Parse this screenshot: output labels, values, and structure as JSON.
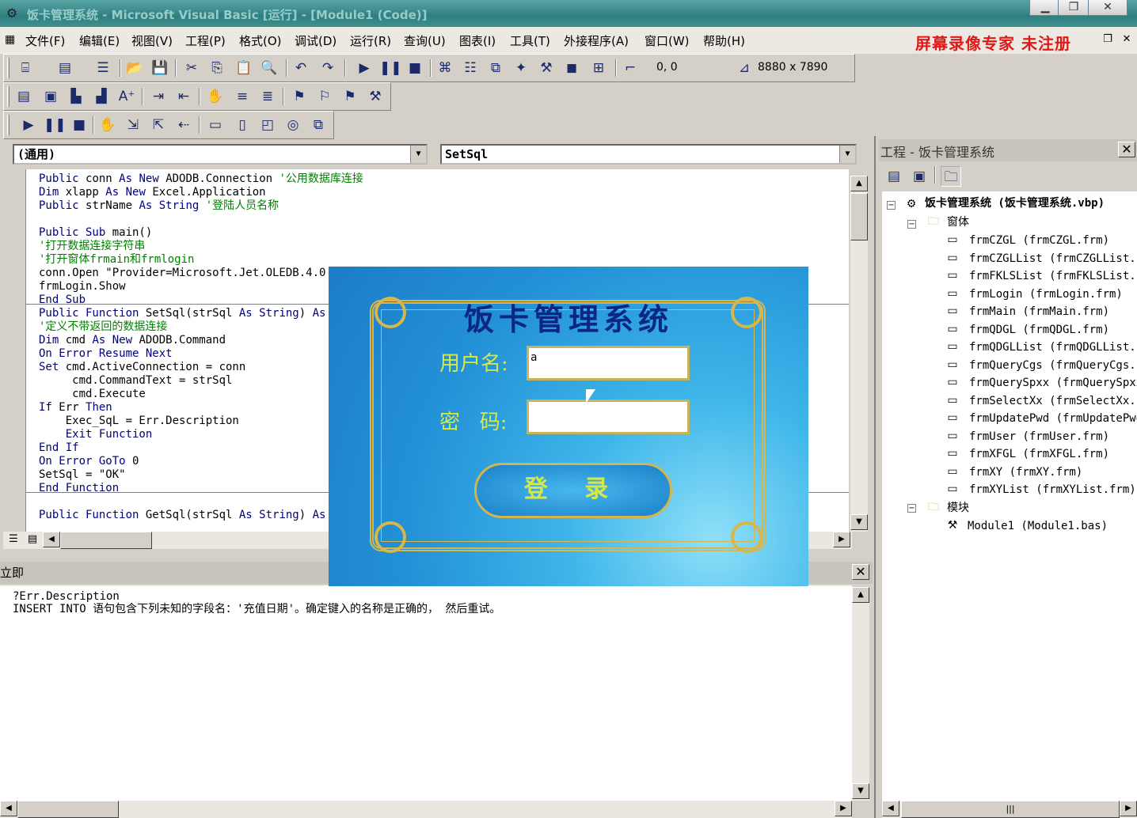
{
  "title_bar": {
    "title": "饭卡管理系统 - Microsoft Visual Basic [运行] - [Module1 (Code)]"
  },
  "menu": {
    "items": [
      "文件(F)",
      "编辑(E)",
      "视图(V)",
      "工程(P)",
      "格式(O)",
      "调试(D)",
      "运行(R)",
      "查询(U)",
      "图表(I)",
      "工具(T)",
      "外接程序(A)",
      "窗口(W)",
      "帮助(H)"
    ],
    "recorder_label": "屏幕录像专家  未注册"
  },
  "toolbar": {
    "position": "0, 0",
    "size": "8880 x 7890"
  },
  "code_window": {
    "object_combo": "(通用)",
    "procedure_combo": "SetSql",
    "lines": [
      [
        {
          "t": "Public ",
          "c": "kw"
        },
        {
          "t": "conn ",
          "c": ""
        },
        {
          "t": "As New ",
          "c": "kw"
        },
        {
          "t": "ADODB.Connection ",
          "c": ""
        },
        {
          "t": "'公用数据库连接",
          "c": "cm"
        }
      ],
      [
        {
          "t": "Dim ",
          "c": "kw"
        },
        {
          "t": "xlapp ",
          "c": ""
        },
        {
          "t": "As New ",
          "c": "kw"
        },
        {
          "t": "Excel.Application",
          "c": ""
        }
      ],
      [
        {
          "t": "Public ",
          "c": "kw"
        },
        {
          "t": "strName ",
          "c": ""
        },
        {
          "t": "As String ",
          "c": "kw"
        },
        {
          "t": "'登陆人员名称",
          "c": "cm"
        }
      ],
      [],
      [
        {
          "t": "Public Sub ",
          "c": "kw"
        },
        {
          "t": "main()",
          "c": ""
        }
      ],
      [
        {
          "t": "'打开数据连接字符串",
          "c": "cm"
        }
      ],
      [
        {
          "t": "'打开窗体frmain和frmlogin",
          "c": "cm"
        }
      ],
      [
        {
          "t": "conn.Open \"Provider=Microsoft.Jet.OLEDB.4.0",
          "c": ""
        }
      ],
      [
        {
          "t": "frmLogin.Show",
          "c": ""
        }
      ],
      [
        {
          "t": "End Sub",
          "c": "kw"
        }
      ],
      [
        {
          "t": "Public Function ",
          "c": "kw"
        },
        {
          "t": "SetSql(strSql ",
          "c": ""
        },
        {
          "t": "As String",
          "c": "kw"
        },
        {
          "t": ") ",
          "c": ""
        },
        {
          "t": "As",
          "c": "kw"
        }
      ],
      [
        {
          "t": "'定义不带返回的数据连接",
          "c": "cm"
        }
      ],
      [
        {
          "t": "Dim ",
          "c": "kw"
        },
        {
          "t": "cmd ",
          "c": ""
        },
        {
          "t": "As New ",
          "c": "kw"
        },
        {
          "t": "ADODB.Command",
          "c": ""
        }
      ],
      [
        {
          "t": "On Error Resume Next",
          "c": "kw"
        }
      ],
      [
        {
          "t": "Set ",
          "c": "kw"
        },
        {
          "t": "cmd.ActiveConnection = conn",
          "c": ""
        }
      ],
      [
        {
          "t": "     cmd.CommandText = strSql",
          "c": ""
        }
      ],
      [
        {
          "t": "     cmd.Execute",
          "c": ""
        }
      ],
      [
        {
          "t": "If ",
          "c": "kw"
        },
        {
          "t": "Err ",
          "c": ""
        },
        {
          "t": "Then",
          "c": "kw"
        }
      ],
      [
        {
          "t": "    Exec_SqL = Err.Description",
          "c": ""
        }
      ],
      [
        {
          "t": "    Exit Function",
          "c": "kw"
        }
      ],
      [
        {
          "t": "End If",
          "c": "kw"
        }
      ],
      [
        {
          "t": "On Error GoTo ",
          "c": "kw"
        },
        {
          "t": "0",
          "c": ""
        }
      ],
      [
        {
          "t": "SetSql = \"OK\"",
          "c": ""
        }
      ],
      [
        {
          "t": "End Function",
          "c": "kw"
        }
      ],
      [],
      [
        {
          "t": "Public Function ",
          "c": "kw"
        },
        {
          "t": "GetSql(strSql ",
          "c": ""
        },
        {
          "t": "As String",
          "c": "kw"
        },
        {
          "t": ") ",
          "c": ""
        },
        {
          "t": "As",
          "c": "kw"
        }
      ]
    ]
  },
  "immediate": {
    "title": "立即",
    "lines": [
      "?Err.Description",
      "INSERT INTO 语句包含下列未知的字段名：'充值日期'。确定键入的名称是正确的， 然后重试。"
    ]
  },
  "project": {
    "title": "工程 - 饭卡管理系统",
    "root": "饭卡管理系统 (饭卡管理系统.vbp)",
    "forms_folder": "窗体",
    "forms": [
      "frmCZGL (frmCZGL.frm)",
      "frmCZGLList (frmCZGLList.frm)",
      "frmFKLSList (frmFKLSList.frm)",
      "frmLogin (frmLogin.frm)",
      "frmMain (frmMain.frm)",
      "frmQDGL (frmQDGL.frm)",
      "frmQDGLList (frmQDGLList.frm)",
      "frmQueryCgs (frmQueryCgs.frm)",
      "frmQuerySpxx (frmQuerySpxx.frm)",
      "frmSelectXx (frmSelectXx.frm)",
      "frmUpdatePwd (frmUpdatePwd.frm)",
      "frmUser (frmUser.frm)",
      "frmXFGL (frmXFGL.frm)",
      "frmXY (frmXY.frm)",
      "frmXYList (frmXYList.frm)"
    ],
    "modules_folder": "模块",
    "modules": [
      "Module1 (Module1.bas)"
    ]
  },
  "login_form": {
    "title": "饭卡管理系统",
    "username_label": "用户名:",
    "username_value": "a",
    "password_label": "密   码:",
    "password_value": "",
    "login_button": "登 录"
  }
}
